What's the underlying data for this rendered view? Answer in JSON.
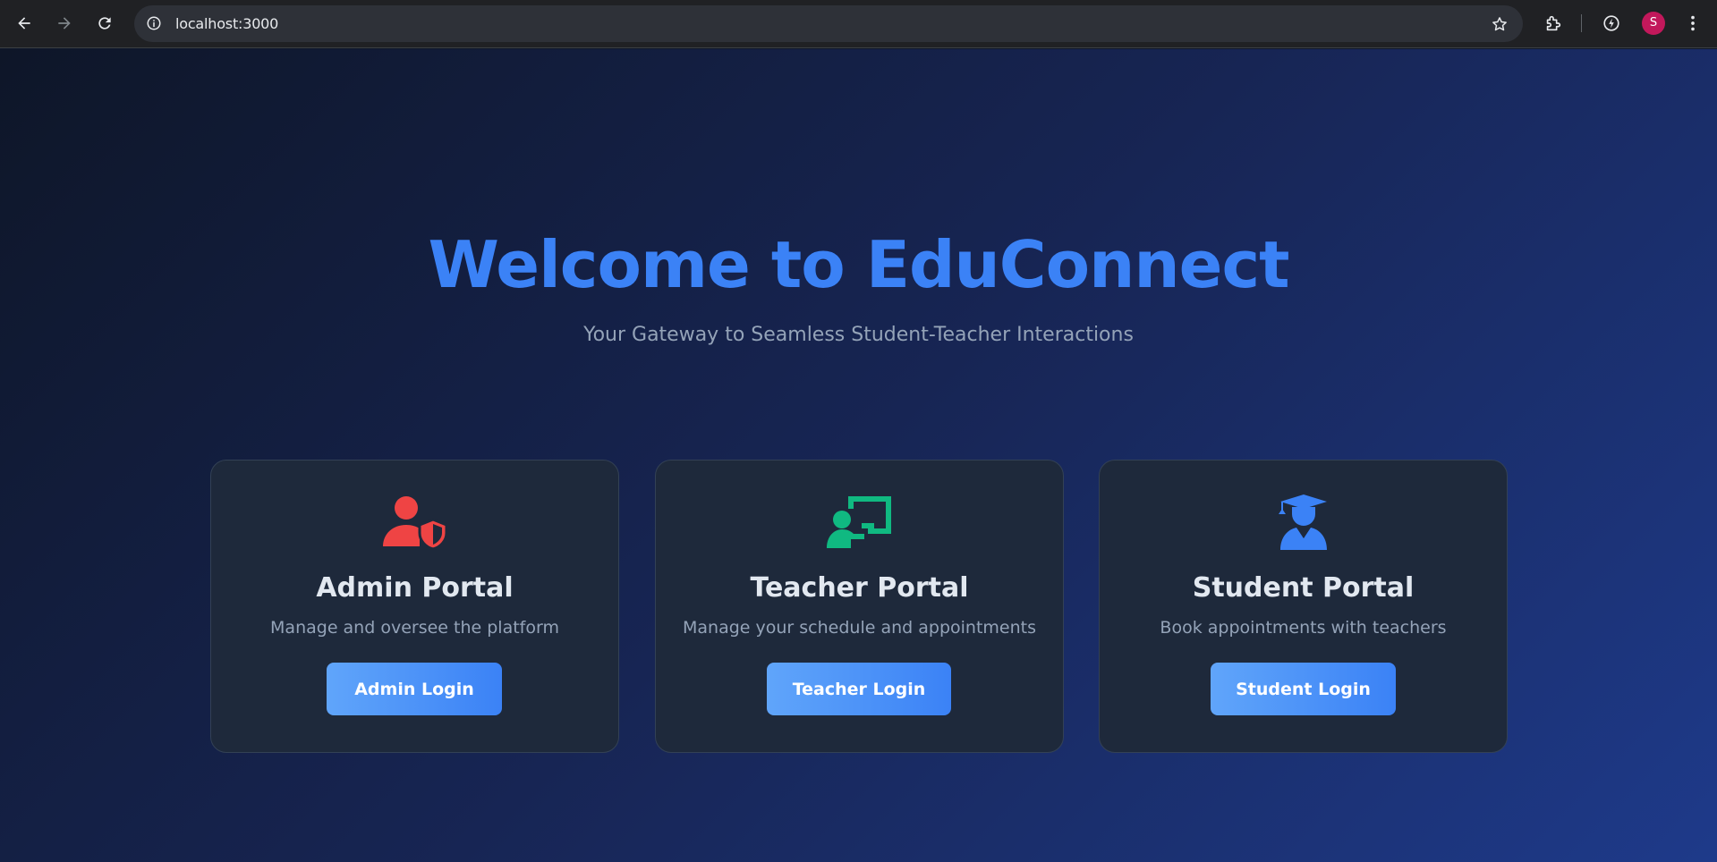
{
  "browser": {
    "url": "localhost:3000",
    "profile_initial": "S",
    "profile_color": "#c2185b"
  },
  "hero": {
    "title": "Welcome to EduConnect",
    "subtitle": "Your Gateway to Seamless Student-Teacher Interactions"
  },
  "portals": [
    {
      "title": "Admin Portal",
      "description": "Manage and oversee the platform",
      "button": "Admin Login",
      "icon": "user-shield-icon",
      "color": "#ef4444"
    },
    {
      "title": "Teacher Portal",
      "description": "Manage your schedule and appointments",
      "button": "Teacher Login",
      "icon": "chalkboard-teacher-icon",
      "color": "#10b981"
    },
    {
      "title": "Student Portal",
      "description": "Book appointments with teachers",
      "button": "Student Login",
      "icon": "graduate-icon",
      "color": "#3b82f6"
    }
  ]
}
